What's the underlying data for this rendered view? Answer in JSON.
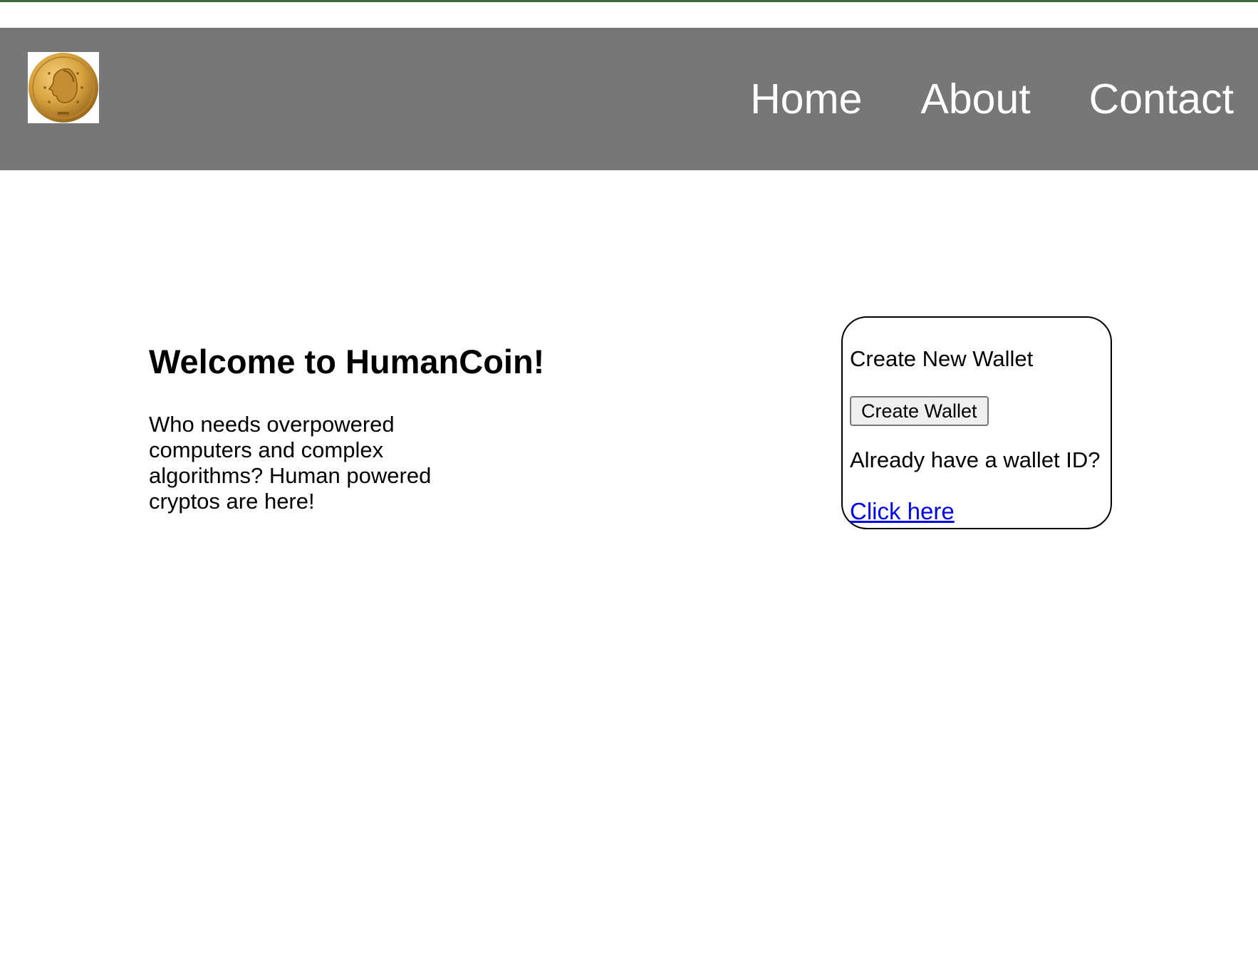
{
  "nav": {
    "logo_icon": "gold-coin-logo-icon",
    "background_color": "#777777",
    "links": [
      {
        "label": "Home"
      },
      {
        "label": "About"
      },
      {
        "label": "Contact"
      }
    ]
  },
  "hero": {
    "title": "Welcome to HumanCoin!",
    "description": "Who needs overpowered computers and complex algorithms? Human powered cryptos are here!"
  },
  "wallet": {
    "heading": "Create New Wallet",
    "create_button_label": "Create Wallet",
    "existing_prompt": "Already have a wallet ID?",
    "link_label": "Click here",
    "link_color": "#0000ee"
  }
}
